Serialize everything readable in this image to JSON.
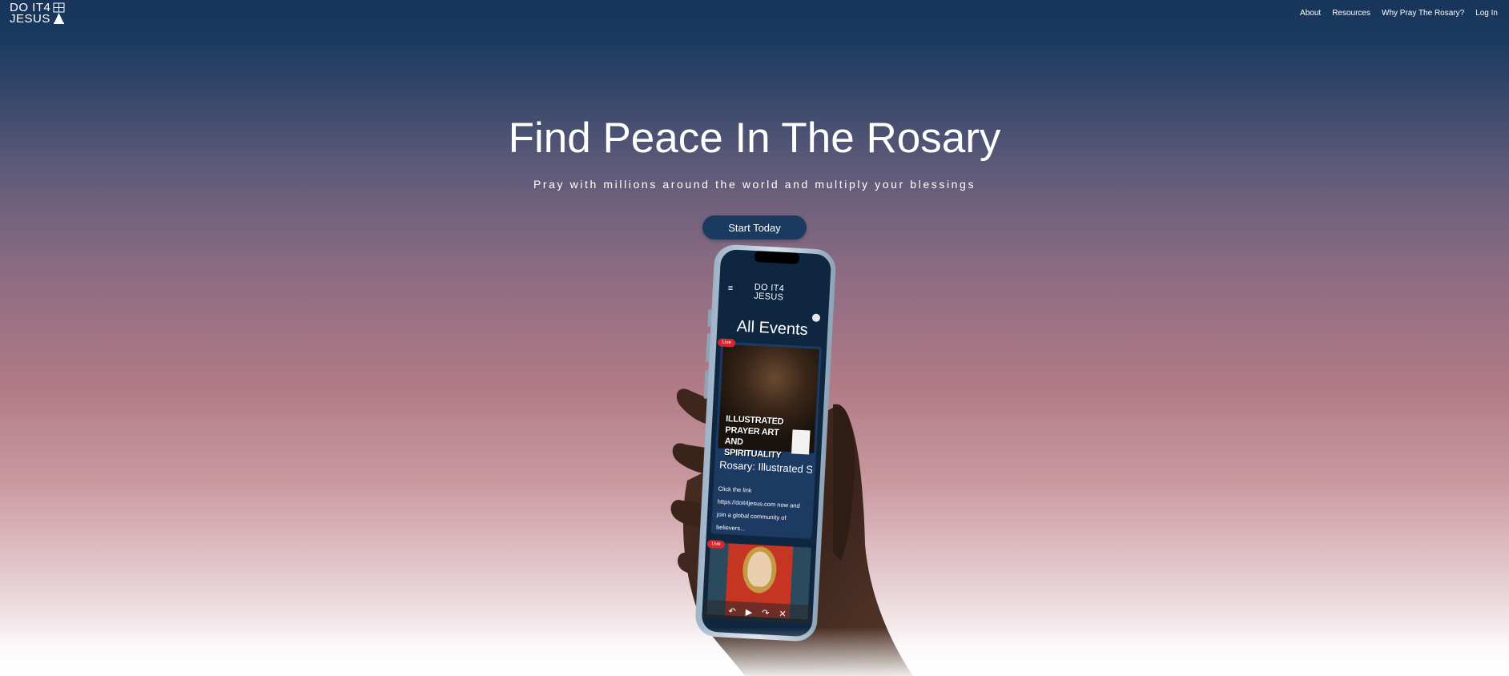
{
  "header": {
    "logo_line1": "DO IT4",
    "logo_line2": "JESUS",
    "nav": [
      "About",
      "Resources",
      "Why Pray The Rosary?",
      "Log In"
    ]
  },
  "hero": {
    "title": "Find Peace In The Rosary",
    "subtitle": "Pray with millions around the world and multiply your blessings",
    "cta_label": "Start Today"
  },
  "phone_screen": {
    "menu_icon": "hamburger-icon",
    "logo_line1": "DO IT4",
    "logo_line2": "JESUS",
    "heading": "All Events",
    "live_badge": "Live",
    "events": [
      {
        "image_text": "ILLUSTRATED PRAYER ART AND SPIRITUALITY",
        "title": "Rosary: Illustrated Sorrowf...",
        "description": "Click the link https://doit4jesus.com now and join a global community of believers..."
      }
    ],
    "second_live_badge": "Live"
  },
  "colors": {
    "navy": "#17355a",
    "button": "#1b3a5f",
    "live_red": "#d7262f"
  }
}
